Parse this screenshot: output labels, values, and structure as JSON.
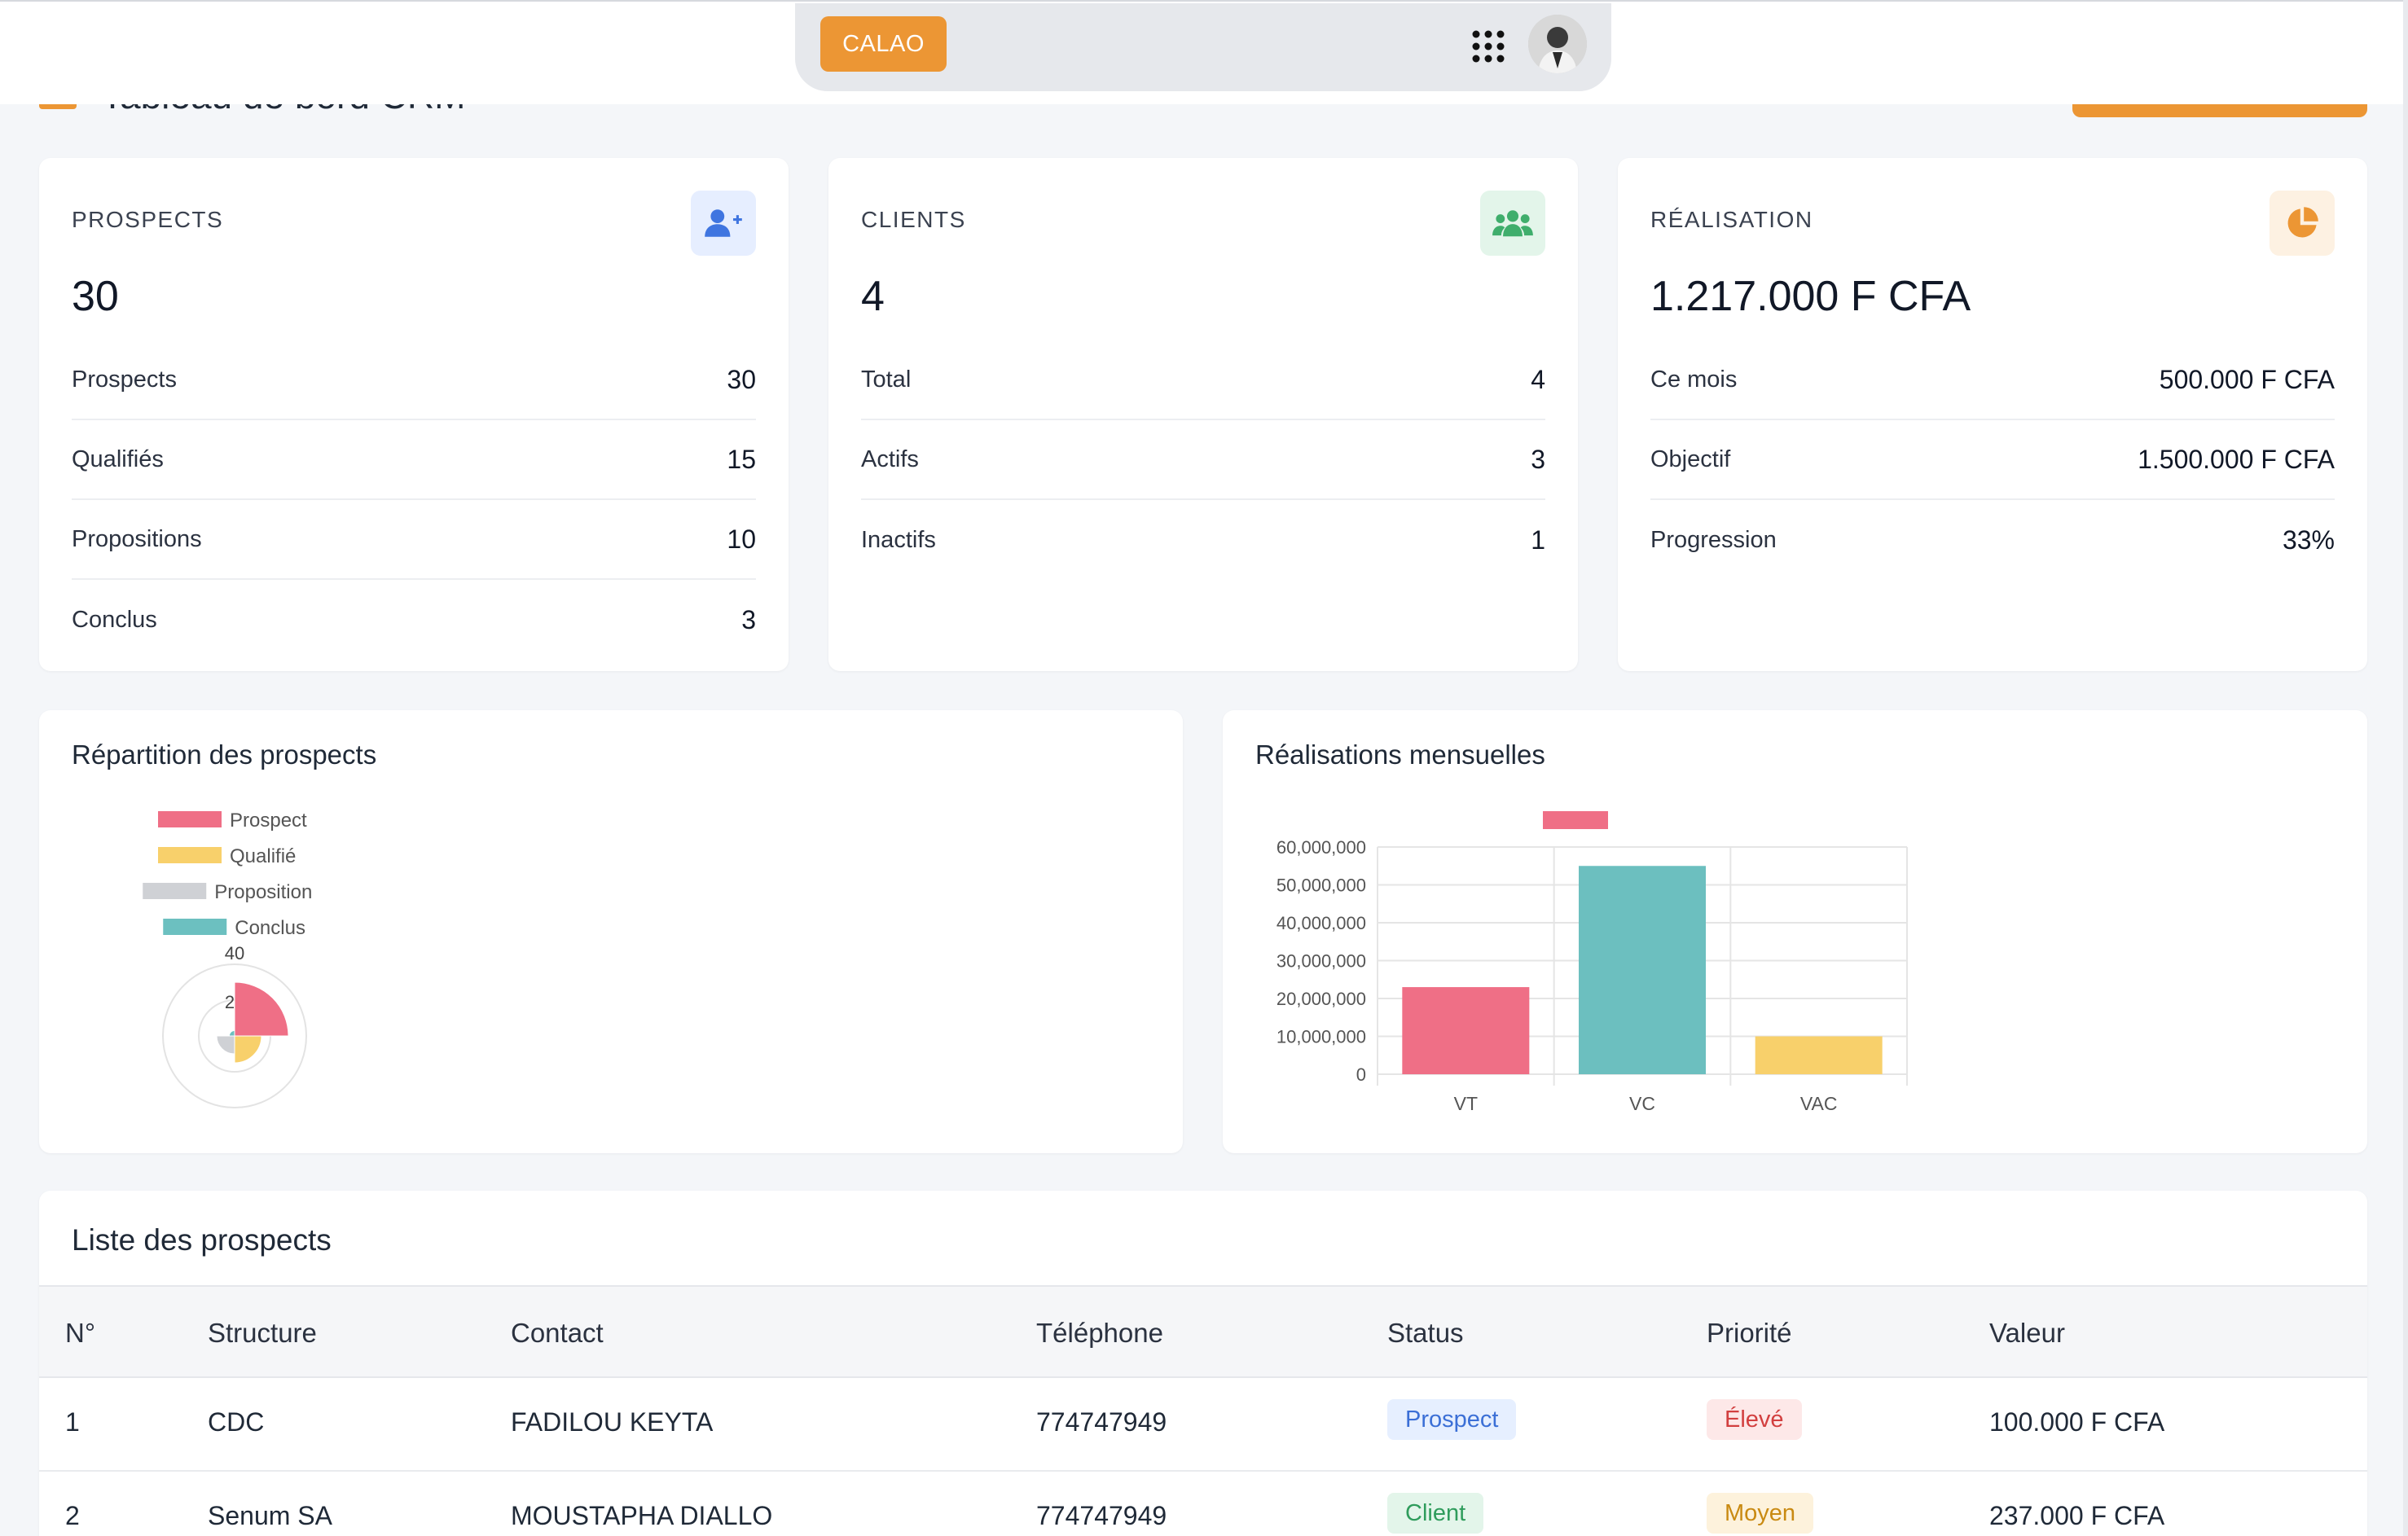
{
  "navbar": {
    "brand": "CALAO",
    "apps_icon": "grid-dots-icon",
    "avatar": "user-avatar"
  },
  "page_header": {
    "title": "Tableau de bord CRM"
  },
  "stats": {
    "prospects": {
      "label": "PROSPECTS",
      "icon": "user-plus-icon",
      "value": "30",
      "rows": [
        {
          "label": "Prospects",
          "value": "30"
        },
        {
          "label": "Qualifiés",
          "value": "15"
        },
        {
          "label": "Propositions",
          "value": "10"
        },
        {
          "label": "Conclus",
          "value": "3"
        }
      ]
    },
    "clients": {
      "label": "CLIENTS",
      "icon": "users-icon",
      "value": "4",
      "rows": [
        {
          "label": "Total",
          "value": "4"
        },
        {
          "label": "Actifs",
          "value": "3"
        },
        {
          "label": "Inactifs",
          "value": "1"
        }
      ]
    },
    "realisation": {
      "label": "RÉALISATION",
      "icon": "pie-chart-icon",
      "value": "1.217.000 F CFA",
      "rows": [
        {
          "label": "Ce mois",
          "value": "500.000 F CFA"
        },
        {
          "label": "Objectif",
          "value": "1.500.000 F CFA"
        },
        {
          "label": "Progression",
          "value": "33%"
        }
      ]
    }
  },
  "charts": {
    "pie_title": "Répartition des prospects",
    "bar_title": "Réalisations mensuelles"
  },
  "chart_data": [
    {
      "type": "pie",
      "variant": "polar-area",
      "categories": [
        "Prospect",
        "Qualifié",
        "Proposition",
        "Conclus"
      ],
      "values": [
        30,
        15,
        10,
        3
      ],
      "colors": [
        "#ef6f86",
        "#f8d06b",
        "#cfd1d5",
        "#6cc0c0"
      ],
      "radial_ticks": [
        "2",
        "40"
      ],
      "rlim": [
        0,
        40
      ],
      "legend": "top"
    },
    {
      "type": "bar",
      "categories": [
        "VT",
        "VC",
        "VAC"
      ],
      "values": [
        23000000,
        55000000,
        10000000
      ],
      "colors": [
        "#ef6f86",
        "#6cbfbf",
        "#f8d06b"
      ],
      "yticks": [
        "0",
        "10,000,000",
        "20,000,000",
        "30,000,000",
        "40,000,000",
        "50,000,000",
        "60,000,000"
      ],
      "ylim": [
        0,
        60000000
      ],
      "legend_color": "#ef6f86",
      "grid": true,
      "legend": "top"
    }
  ],
  "table": {
    "title": "Liste des prospects",
    "headers": [
      "N°",
      "Structure",
      "Contact",
      "Téléphone",
      "Status",
      "Priorité",
      "Valeur"
    ],
    "rows": [
      {
        "n": "1",
        "structure": "CDC",
        "contact": "FADILOU KEYTA",
        "phone": "774747949",
        "status": "Prospect",
        "priority": "Élevé",
        "value": "100.000 F CFA"
      },
      {
        "n": "2",
        "structure": "Senum SA",
        "contact": "MOUSTAPHA DIALLO",
        "phone": "774747949",
        "status": "Client",
        "priority": "Moyen",
        "value": "237.000 F CFA"
      }
    ]
  },
  "colors": {
    "accent": "#ec9634",
    "status_prospect_bg": "#e6efff",
    "status_prospect_fg": "#3b6fd6",
    "status_client_bg": "#e3f5ea",
    "status_client_fg": "#2f9c5c",
    "priority_high_bg": "#fde8e8",
    "priority_high_fg": "#d23f3f",
    "priority_mid_bg": "#fdf2dc",
    "priority_mid_fg": "#c98a12"
  }
}
